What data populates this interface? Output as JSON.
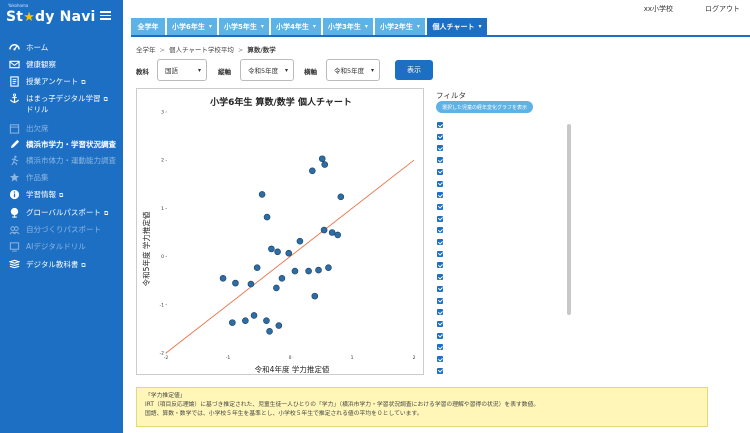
{
  "header": {
    "logo_small": "Yokohama",
    "logo_prefix": "St",
    "logo_star": "★",
    "logo_suffix": "dy Navi",
    "school_name": "xx小学校",
    "logout": "ログアウト"
  },
  "sidebar": {
    "items": [
      {
        "label": "ホーム",
        "icon": "dashboard-icon",
        "ext": "",
        "style": "normal"
      },
      {
        "label": "健康観察",
        "icon": "mail-icon",
        "ext": "",
        "style": "normal"
      },
      {
        "label": "授業アンケート",
        "icon": "survey-icon",
        "ext": "⧉",
        "style": "normal"
      },
      {
        "label": "はまっ子デジタル学習",
        "label2": "ドリル",
        "icon": "anchor-icon",
        "ext": "⧉",
        "style": "normal"
      },
      {
        "label": "出欠席",
        "icon": "attendance-icon",
        "ext": "",
        "style": "dim"
      },
      {
        "label": "横浜市学力・学習状況調査",
        "icon": "pencil-icon",
        "ext": "",
        "style": "bold"
      },
      {
        "label": "横浜市体力・運動能力調査",
        "icon": "fitness-icon",
        "ext": "",
        "style": "dim"
      },
      {
        "label": "作品集",
        "icon": "gallery-icon",
        "ext": "",
        "style": "dim"
      },
      {
        "label": "学習情報",
        "icon": "info-icon",
        "ext": "⧉",
        "style": "normal"
      },
      {
        "label": "グローバルパスポート",
        "icon": "globe-icon",
        "ext": "⧉",
        "style": "normal"
      },
      {
        "label": "自分づくりパスポート",
        "icon": "passport-icon",
        "ext": "",
        "style": "dim"
      },
      {
        "label": "AIデジタルドリル",
        "icon": "ai-drill-icon",
        "ext": "",
        "style": "dim"
      },
      {
        "label": "デジタル教科書",
        "icon": "book-icon",
        "ext": "⧉",
        "style": "normal"
      }
    ]
  },
  "tabs": [
    {
      "label": "全学年",
      "chevron": false,
      "active": false
    },
    {
      "label": "小学6年生",
      "chevron": true,
      "active": false
    },
    {
      "label": "小学5年生",
      "chevron": true,
      "active": false
    },
    {
      "label": "小学4年生",
      "chevron": true,
      "active": false
    },
    {
      "label": "小学3年生",
      "chevron": true,
      "active": false
    },
    {
      "label": "小学2年生",
      "chevron": true,
      "active": false
    },
    {
      "label": "個人チャート",
      "chevron": true,
      "active": true
    }
  ],
  "breadcrumb": [
    "全学年",
    "個人チャート学校平均",
    "算数/数学"
  ],
  "filters": {
    "subject_label": "教科",
    "subject_value": "国語",
    "vaxis_label": "縦軸",
    "vaxis_value": "令和5年度",
    "haxis_label": "横軸",
    "haxis_value": "令和5年度",
    "show_button": "表示"
  },
  "filter_panel": {
    "title": "フィルタ",
    "button": "選択した児童の経年変化グラフを表示"
  },
  "note": {
    "line1": "「学力推定値」",
    "line2": "IRT（項目反応理論）に基づき推定された、児童生徒一人ひとりの「学力」（横浜市学力・学習状況調査における学習の理解や習得の状況）を表す数値。",
    "line3": "国語、算数・数学では、小学校５年生を基準とし、小学校５年生で推定される値の平均を０としています。"
  },
  "chart_data": {
    "type": "scatter",
    "title": "小学6年生 算数/数学 個人チャート",
    "xlabel": "令和4年度 学力推定値",
    "ylabel": "令和5年度 学力推定値",
    "xlim": [
      -2,
      2
    ],
    "ylim": [
      -2,
      3
    ],
    "x_ticks": [
      "-2",
      "-1",
      "0",
      "1",
      "2"
    ],
    "y_ticks": [
      "-2",
      "-1",
      "0",
      "1",
      "2",
      "3"
    ],
    "reference_line": {
      "from": [
        -2,
        -2
      ],
      "to": [
        2,
        2
      ],
      "color": "#e8734a"
    },
    "point_color": "#2e6da4",
    "points": [
      {
        "x": -1.08,
        "y": -0.45
      },
      {
        "x": -0.93,
        "y": -1.37
      },
      {
        "x": -0.88,
        "y": -0.55
      },
      {
        "x": -0.72,
        "y": -1.33
      },
      {
        "x": -0.63,
        "y": -0.57
      },
      {
        "x": -0.58,
        "y": -1.22
      },
      {
        "x": -0.53,
        "y": -0.23
      },
      {
        "x": -0.45,
        "y": 1.29
      },
      {
        "x": -0.37,
        "y": 0.82
      },
      {
        "x": -0.38,
        "y": -1.33
      },
      {
        "x": -0.33,
        "y": -1.55
      },
      {
        "x": -0.3,
        "y": 0.16
      },
      {
        "x": -0.22,
        "y": -0.65
      },
      {
        "x": -0.2,
        "y": 0.1
      },
      {
        "x": -0.18,
        "y": -1.43
      },
      {
        "x": -0.13,
        "y": -0.45
      },
      {
        "x": -0.02,
        "y": 0.07
      },
      {
        "x": 0.08,
        "y": -0.3
      },
      {
        "x": 0.16,
        "y": 0.32
      },
      {
        "x": 0.3,
        "y": -0.3
      },
      {
        "x": 0.36,
        "y": 1.78
      },
      {
        "x": 0.4,
        "y": -0.82
      },
      {
        "x": 0.46,
        "y": -0.28
      },
      {
        "x": 0.52,
        "y": 2.03
      },
      {
        "x": 0.56,
        "y": 1.91
      },
      {
        "x": 0.55,
        "y": 0.55
      },
      {
        "x": 0.62,
        "y": -0.23
      },
      {
        "x": 0.68,
        "y": 0.5
      },
      {
        "x": 0.77,
        "y": 0.45
      },
      {
        "x": 0.82,
        "y": 1.24
      }
    ]
  }
}
